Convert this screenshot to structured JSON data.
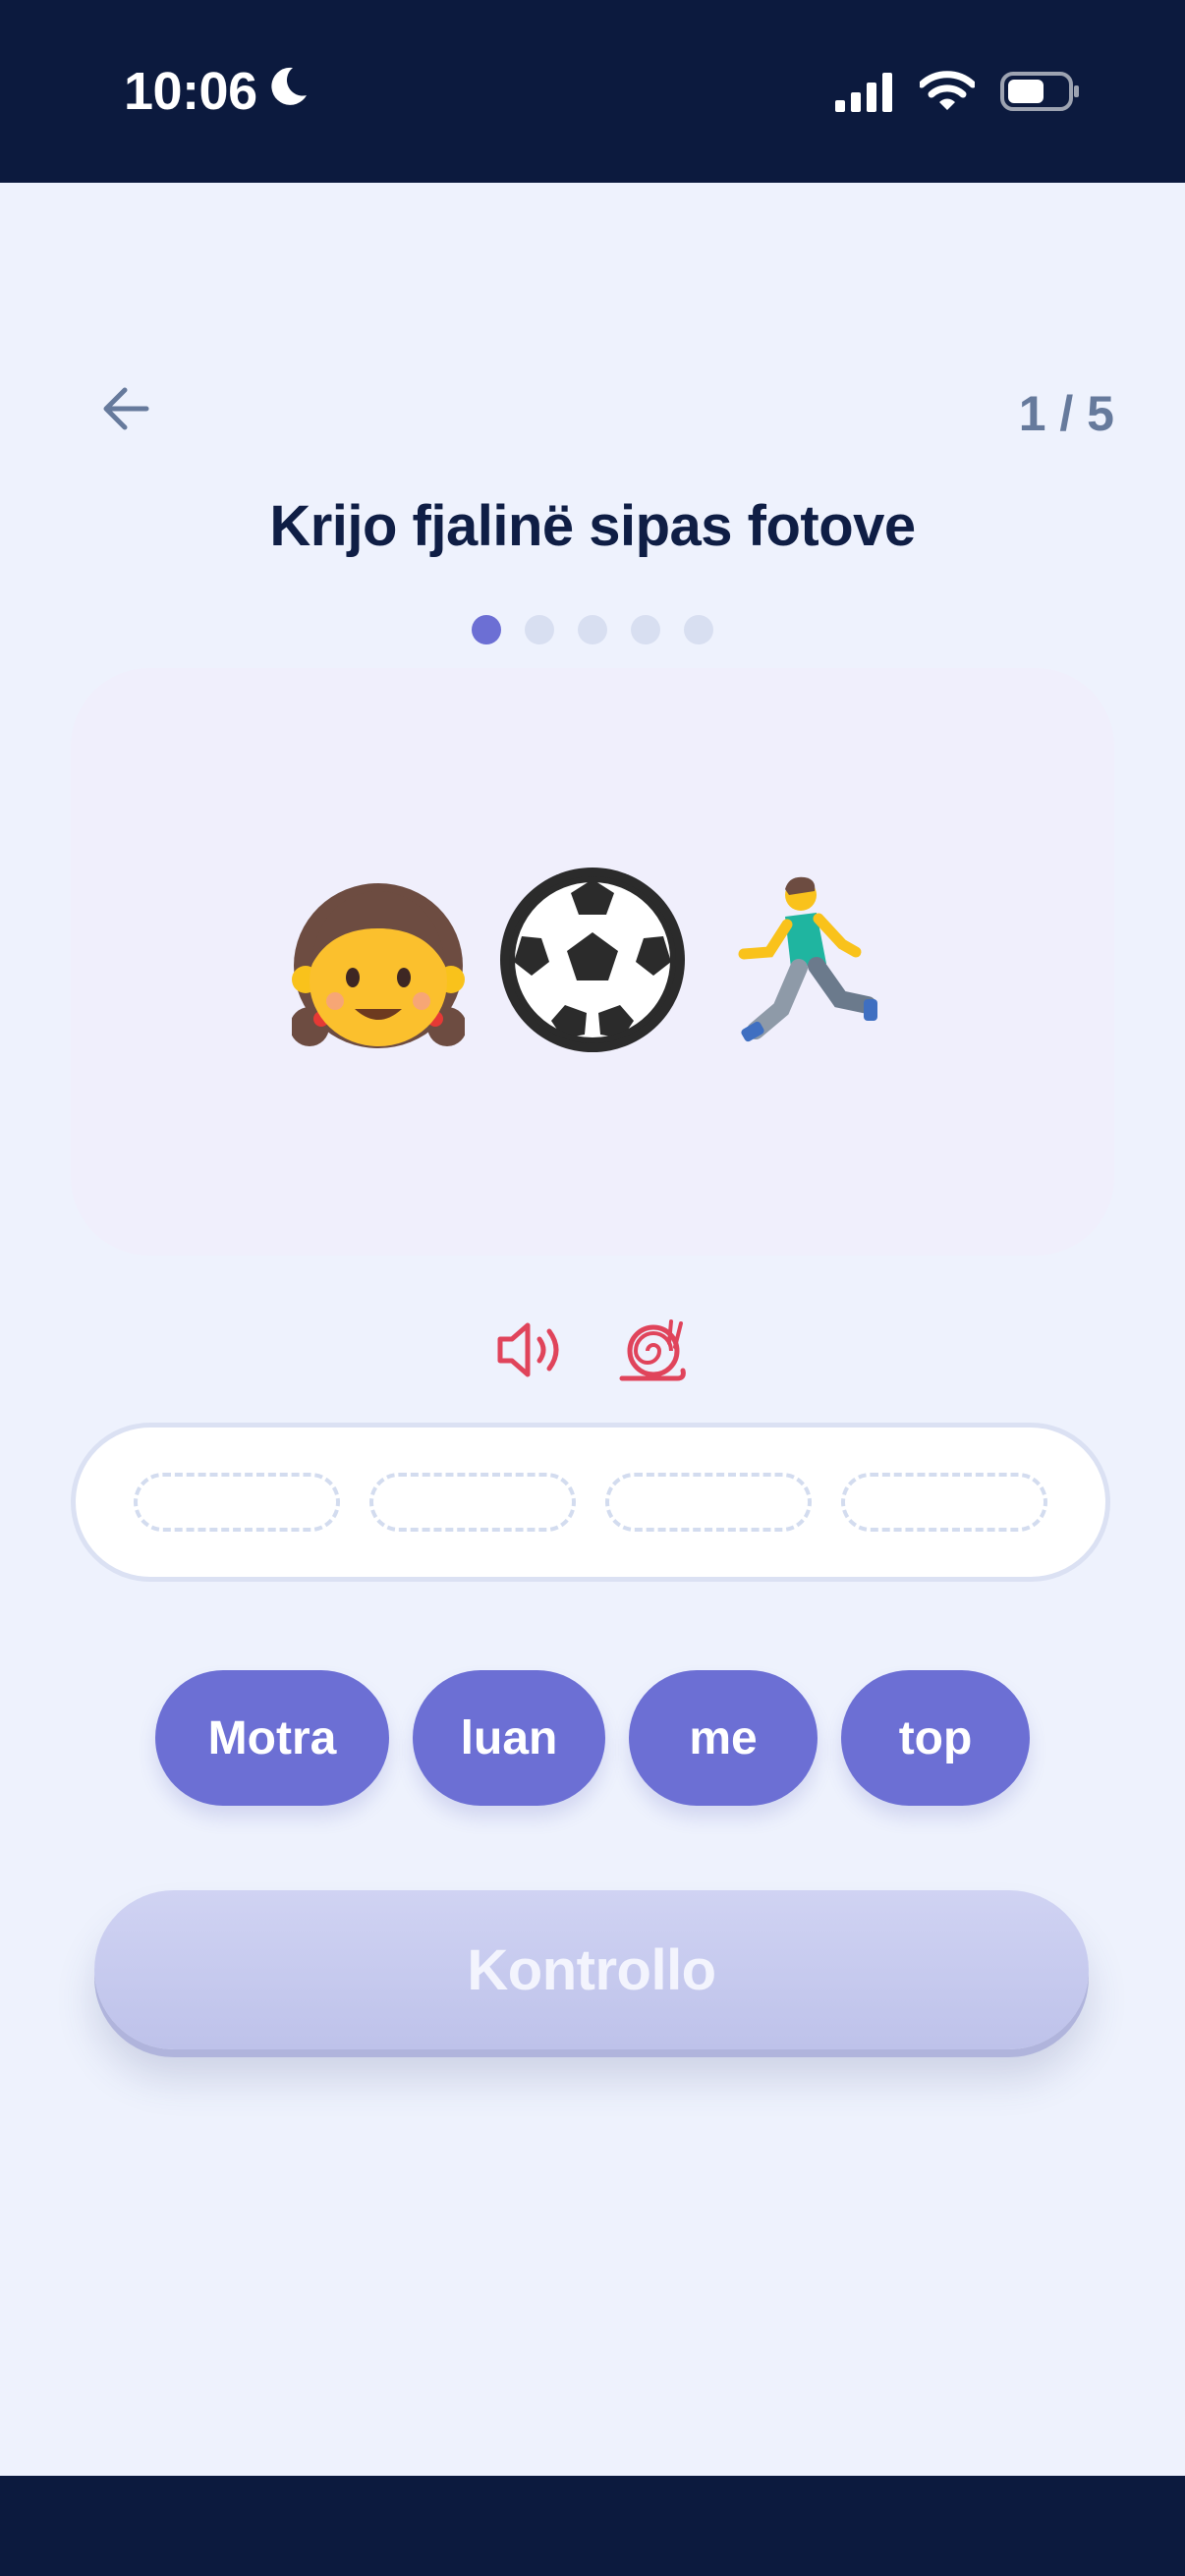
{
  "status_bar": {
    "time": "10:06",
    "icons": [
      "moon-icon",
      "signal-icon",
      "wifi-icon",
      "battery-icon"
    ]
  },
  "header": {
    "back_icon": "arrow-left-icon",
    "progress": "1 / 5",
    "title": "Krijo fjalinë sipas fotove"
  },
  "step_dots": {
    "total": 5,
    "current": 1
  },
  "picture_card": {
    "emojis": [
      "girl",
      "soccer-ball",
      "running-man"
    ]
  },
  "audio_controls": [
    {
      "icon": "speaker-icon"
    },
    {
      "icon": "snail-icon"
    }
  ],
  "answer_slots": 4,
  "word_bank": [
    {
      "label": "Motra"
    },
    {
      "label": "luan"
    },
    {
      "label": "me"
    },
    {
      "label": "top"
    }
  ],
  "check_button": {
    "label": "Kontrollo"
  },
  "colors": {
    "accent": "#6c6fd4",
    "background": "#eef2fd",
    "status_bar": "#0c1a3e",
    "audio_icon": "#e0445b"
  }
}
